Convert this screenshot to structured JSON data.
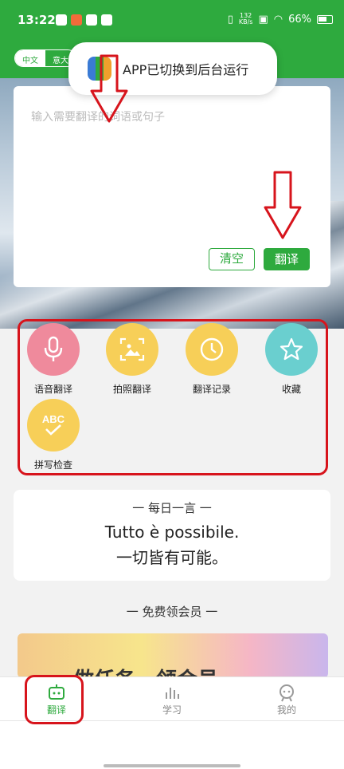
{
  "status_bar": {
    "time": "13:22",
    "net_speed_value": "132",
    "net_speed_unit": "KB/s",
    "battery": "66%"
  },
  "lang_switch": {
    "source": "中文",
    "target": "意大"
  },
  "toast": {
    "message": "APP已切换到后台运行"
  },
  "input": {
    "placeholder": "输入需要翻译的词语或句子",
    "clear_label": "清空",
    "translate_label": "翻译"
  },
  "features": [
    {
      "label": "语音翻译",
      "icon": "microphone-icon"
    },
    {
      "label": "拍照翻译",
      "icon": "photo-scan-icon"
    },
    {
      "label": "翻译记录",
      "icon": "clock-icon"
    },
    {
      "label": "收藏",
      "icon": "star-icon"
    },
    {
      "label": "拼写检查",
      "icon": "abc-check-icon"
    }
  ],
  "daily": {
    "heading": "一 每日一言 一",
    "italian": "Tutto è possibile.",
    "chinese": "一切皆有可能。"
  },
  "free_member": {
    "title": "一 免费领会员 一",
    "banner_text": "做任务，领会员"
  },
  "tabs": [
    {
      "label": "翻译",
      "icon": "robot-icon",
      "active": true
    },
    {
      "label": "学习",
      "icon": "bars-icon",
      "active": false
    },
    {
      "label": "我的",
      "icon": "profile-icon",
      "active": false
    }
  ],
  "colors": {
    "brand": "#2eaa3e",
    "annotation": "#d7141c"
  }
}
